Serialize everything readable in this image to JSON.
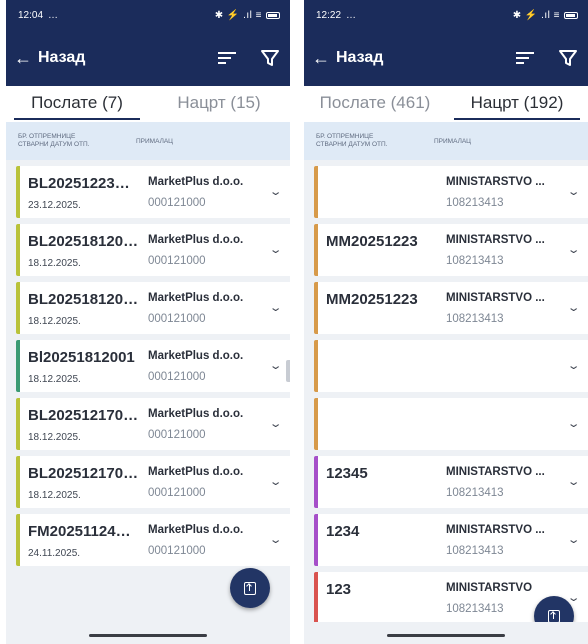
{
  "screens": [
    {
      "status": {
        "time": "12:04",
        "extra": "…",
        "right": "✱ ⚡ .ıl ≡"
      },
      "back_label": "Назад",
      "tabs": [
        {
          "label": "Послате (7)",
          "active": true
        },
        {
          "label": "Нацрт (15)",
          "active": false
        }
      ],
      "columns": {
        "col1_line1": "БР. ОТПРЕМНИЦЕ",
        "col1_line2": "СТВАРНИ ДАТУМ ОТП.",
        "col2": "ПРИМАЛАЦ"
      },
      "rows": [
        {
          "number": "BL20251223…",
          "date": "23.12.2025.",
          "recipient": "MarketPlus d.o.o.",
          "code": "000121000",
          "color": "#b9c23a"
        },
        {
          "number": "BL202518120…",
          "date": "18.12.2025.",
          "recipient": "MarketPlus d.o.o.",
          "code": "000121000",
          "color": "#b9c23a"
        },
        {
          "number": "BL202518120…",
          "date": "18.12.2025.",
          "recipient": "MarketPlus d.o.o.",
          "code": "000121000",
          "color": "#b9c23a"
        },
        {
          "number": "Bl20251812001",
          "date": "18.12.2025.",
          "recipient": "MarketPlus d.o.o.",
          "code": "000121000",
          "color": "#3b9a73"
        },
        {
          "number": "BL202512170…",
          "date": "18.12.2025.",
          "recipient": "MarketPlus d.o.o.",
          "code": "000121000",
          "color": "#b9c23a"
        },
        {
          "number": "BL202512170…",
          "date": "18.12.2025.",
          "recipient": "MarketPlus d.o.o.",
          "code": "000121000",
          "color": "#b9c23a"
        },
        {
          "number": "FM20251124…",
          "date": "24.11.2025.",
          "recipient": "MarketPlus d.o.o.",
          "code": "000121000",
          "color": "#b9c23a"
        }
      ]
    },
    {
      "status": {
        "time": "12:22",
        "extra": "…",
        "right": "✱ ⚡ .ıl ≡"
      },
      "back_label": "Назад",
      "tabs": [
        {
          "label": "Послате (461)",
          "active": false
        },
        {
          "label": "Нацрт (192)",
          "active": true
        }
      ],
      "columns": {
        "col1_line1": "БР. ОТПРЕМНИЦЕ",
        "col1_line2": "СТВАРНИ ДАТУМ ОТП.",
        "col2": "ПРИМАЛАЦ"
      },
      "rows": [
        {
          "number": "",
          "date": "",
          "recipient": "MINISTARSTVO ...",
          "code": "108213413",
          "color": "#d79a4a"
        },
        {
          "number": "MM20251223",
          "date": "",
          "recipient": "MINISTARSTVO ...",
          "code": "108213413",
          "color": "#d79a4a"
        },
        {
          "number": "MM20251223",
          "date": "",
          "recipient": "MINISTARSTVO ...",
          "code": "108213413",
          "color": "#d79a4a"
        },
        {
          "number": "",
          "date": "",
          "recipient": "",
          "code": "",
          "color": "#d79a4a"
        },
        {
          "number": "",
          "date": "",
          "recipient": "",
          "code": "",
          "color": "#d79a4a"
        },
        {
          "number": "12345",
          "date": "",
          "recipient": "MINISTARSTVO ...",
          "code": "108213413",
          "color": "#a64fc9"
        },
        {
          "number": "1234",
          "date": "",
          "recipient": "MINISTARSTVO ...",
          "code": "108213413",
          "color": "#a64fc9"
        },
        {
          "number": "123",
          "date": "",
          "recipient": "MINISTARSTVO",
          "code": "108213413",
          "color": "#d9534f"
        }
      ]
    }
  ],
  "theme": {
    "header_bg": "#1b2c5b",
    "fab_bg": "#223565",
    "list_bg": "#eef1f5",
    "colhead_bg": "#dfeaf6"
  },
  "icons": {
    "back": "arrow-left-icon",
    "sort": "sort-icon",
    "filter": "filter-icon",
    "expand": "chevron-down-icon",
    "fab": "upload-icon"
  }
}
